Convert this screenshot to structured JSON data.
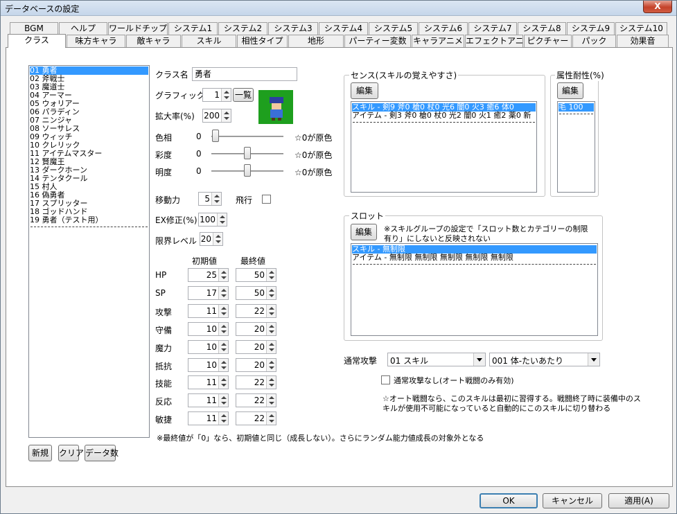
{
  "window": {
    "title": "データベースの設定",
    "close_label": "X"
  },
  "tabs_row1": [
    "BGM",
    "ヘルプ",
    "ワールドチップ",
    "システム1",
    "システム2",
    "システム3",
    "システム4",
    "システム5",
    "システム6",
    "システム7",
    "システム8",
    "システム9",
    "システム10"
  ],
  "tabs_row2": [
    "クラス",
    "味方キャラ",
    "敵キャラ",
    "スキル",
    "相性タイプ",
    "地形",
    "パーティー変数",
    "キャラアニメ",
    "エフェクトアニメ",
    "ピクチャー",
    "パック",
    "効果音"
  ],
  "active_tab": "クラス",
  "class_list": [
    "01 勇者",
    "02 斧戦士",
    "03 魔道士",
    "04 アーマー",
    "05 ウォリアー",
    "06 パラディン",
    "07 ニンジャ",
    "08 ソーサレス",
    "09 ウィッチ",
    "10 クレリック",
    "11 アイテムマスター",
    "12 賢魔王",
    "13 ダークホーン",
    "14 テンタクール",
    "15 村人",
    "16 偽勇者",
    "17 スプリッター",
    "18 ゴッドハンド",
    "19 勇者（テスト用）"
  ],
  "list_buttons": {
    "new": "新規",
    "clear": "クリア",
    "count": "データ数"
  },
  "form": {
    "class_name_label": "クラス名",
    "class_name_value": "勇者",
    "graphic_label": "グラフィック",
    "graphic_value": "1",
    "graphic_list_button": "一覧",
    "scale_label": "拡大率(%)",
    "scale_value": "200",
    "hue_label": "色相",
    "hue_value": "0",
    "hue_note": "☆0が原色",
    "sat_label": "彩度",
    "sat_value": "0",
    "sat_note": "☆0が原色",
    "bright_label": "明度",
    "bright_value": "0",
    "bright_note": "☆0が原色",
    "move_label": "移動力",
    "move_value": "5",
    "fly_label": "飛行",
    "ex_label": "EX修正(%)",
    "ex_value": "100",
    "limit_label": "限界レベル",
    "limit_value": "20",
    "initial_header": "初期値",
    "final_header": "最終値"
  },
  "stats": [
    {
      "label": "HP",
      "initial": "25",
      "final": "50"
    },
    {
      "label": "SP",
      "initial": "17",
      "final": "50"
    },
    {
      "label": "攻撃",
      "initial": "11",
      "final": "22"
    },
    {
      "label": "守備",
      "initial": "10",
      "final": "20"
    },
    {
      "label": "魔力",
      "initial": "10",
      "final": "20"
    },
    {
      "label": "抵抗",
      "initial": "10",
      "final": "20"
    },
    {
      "label": "技能",
      "initial": "11",
      "final": "22"
    },
    {
      "label": "反応",
      "initial": "11",
      "final": "22"
    },
    {
      "label": "敏捷",
      "initial": "11",
      "final": "22"
    }
  ],
  "stats_note": "※最終値が「0」なら、初期値と同じ（成長しない）。さらにランダム能力値成長の対象外となる",
  "sense": {
    "title": "センス(スキルの覚えやすさ)",
    "edit_button": "編集",
    "rows": [
      "スキル - 剣9 斧0 槍0 杖0 光6 闇0 火3 癒6 体0",
      "アイテム - 剣3 斧0 槍0 杖0 光2 闇0 火1 癒2 薬0 新"
    ]
  },
  "attribute": {
    "title": "属性耐性(%)",
    "edit_button": "編集",
    "rows": [
      "毛 100"
    ]
  },
  "slot": {
    "title": "スロット",
    "edit_button": "編集",
    "note_line1": "※スキルグループの設定で「スロット数とカテゴリーの制限",
    "note_line2": "有り」にしないと反映されない",
    "rows": [
      "スキル - 無制限",
      "アイテム - 無制限 無制限 無制限 無制限 無制限"
    ]
  },
  "normal_attack": {
    "label": "通常攻撃",
    "skill_group": "01 スキル",
    "skill": "001 体-たいあたり",
    "none_label": "通常攻撃なし(オート戦闘のみ有効)",
    "note_line1": "☆オート戦闘なら、このスキルは最初に習得する。戦闘終了時に装備中のス",
    "note_line2": "キルが使用不可能になっていると自動的にこのスキルに切り替わる"
  },
  "dialog_buttons": {
    "ok": "OK",
    "cancel": "キャンセル",
    "apply": "適用(A)"
  },
  "colors": {
    "selection": "#3399ff",
    "sprite_bg": "#1e9f1e"
  }
}
